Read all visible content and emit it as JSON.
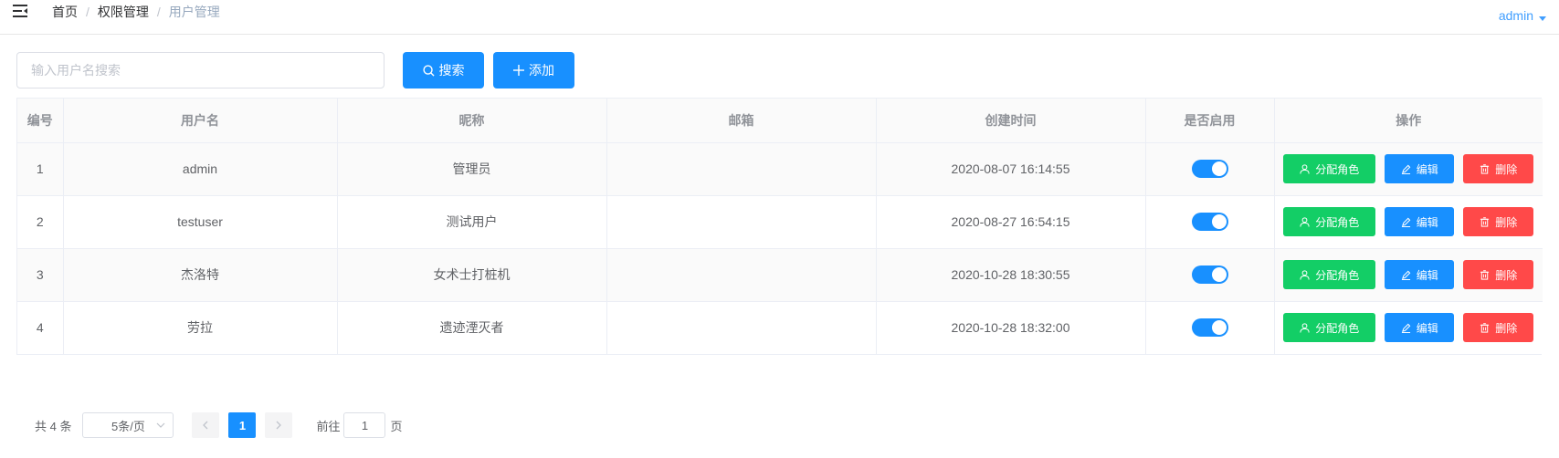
{
  "header": {
    "breadcrumb": [
      "首页",
      "权限管理",
      "用户管理"
    ],
    "separator": "/",
    "user": "admin"
  },
  "toolbar": {
    "search_placeholder": "输入用户名搜索",
    "search_label": "搜索",
    "add_label": "添加"
  },
  "table": {
    "columns": [
      "编号",
      "用户名",
      "昵称",
      "邮箱",
      "创建时间",
      "是否启用",
      "操作"
    ],
    "rows": [
      {
        "id": "1",
        "username": "admin",
        "nickname": "管理员",
        "email": "",
        "created": "2020-08-07 16:14:55",
        "enabled": true
      },
      {
        "id": "2",
        "username": "testuser",
        "nickname": "测试用户",
        "email": "",
        "created": "2020-08-27 16:54:15",
        "enabled": true
      },
      {
        "id": "3",
        "username": "杰洛特",
        "nickname": "女术士打桩机",
        "email": "",
        "created": "2020-10-28 18:30:55",
        "enabled": true
      },
      {
        "id": "4",
        "username": "劳拉",
        "nickname": "遗迹湮灭者",
        "email": "",
        "created": "2020-10-28 18:32:00",
        "enabled": true
      }
    ],
    "actions": {
      "assign_role": "分配角色",
      "edit": "编辑",
      "delete": "删除"
    }
  },
  "pagination": {
    "total_text": "共 4 条",
    "page_size": "5条/页",
    "current_page": "1",
    "goto_prefix": "前往",
    "goto_value": "1",
    "goto_suffix": "页"
  },
  "colors": {
    "primary": "#1890ff",
    "success": "#13ce66",
    "danger": "#ff4949"
  }
}
